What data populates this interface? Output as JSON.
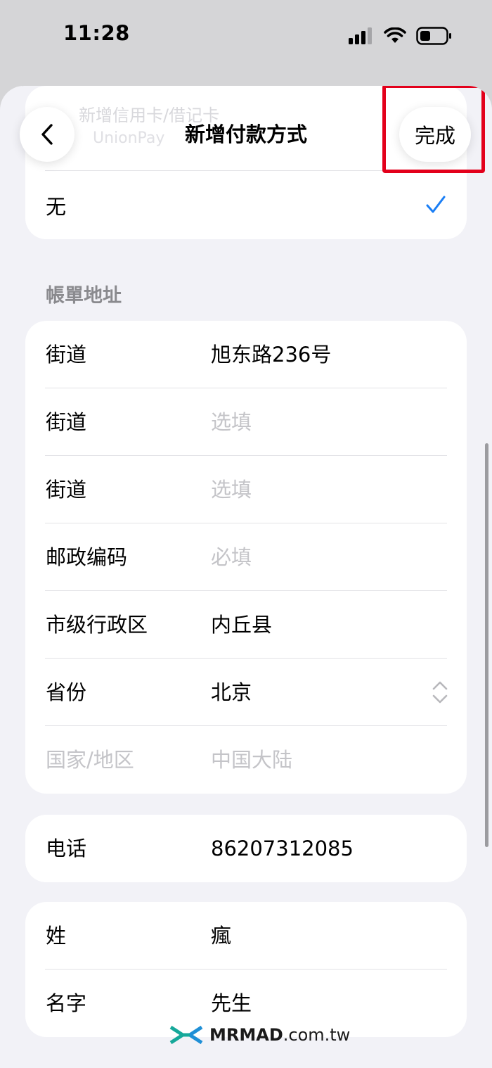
{
  "status_bar": {
    "time": "11:28"
  },
  "background_form": {
    "card_title_ghost": "新增信用卡/借记卡",
    "card_subtitle_ghost": "UnionPay"
  },
  "nav": {
    "title": "新增付款方式",
    "done_label": "完成"
  },
  "selection": {
    "none_label": "无",
    "selected": true
  },
  "billing_address": {
    "header": "帳單地址",
    "rows": [
      {
        "label": "街道",
        "value": "旭东路236号",
        "is_placeholder": false
      },
      {
        "label": "街道",
        "value": "选填",
        "is_placeholder": true
      },
      {
        "label": "街道",
        "value": "选填",
        "is_placeholder": true
      },
      {
        "label": "邮政编码",
        "value": "必填",
        "is_placeholder": true
      },
      {
        "label": "市级行政区",
        "value": "内丘县",
        "is_placeholder": false
      },
      {
        "label": "省份",
        "value": "北京",
        "is_placeholder": false
      },
      {
        "label": "国家/地区",
        "value": "中国大陆",
        "is_placeholder": false,
        "disabled": true
      }
    ]
  },
  "phone": {
    "label": "电话",
    "value": "86207312085"
  },
  "name": {
    "rows": [
      {
        "label": "姓",
        "value": "瘋"
      },
      {
        "label": "名字",
        "value": "先生"
      }
    ]
  },
  "watermark": {
    "brand": "MRMAD",
    "domain": ".com.tw"
  },
  "colors": {
    "accent": "#1a7ef5",
    "highlight": "#e3001b",
    "placeholder": "#c4c4c8",
    "background": "#f2f2f7"
  }
}
